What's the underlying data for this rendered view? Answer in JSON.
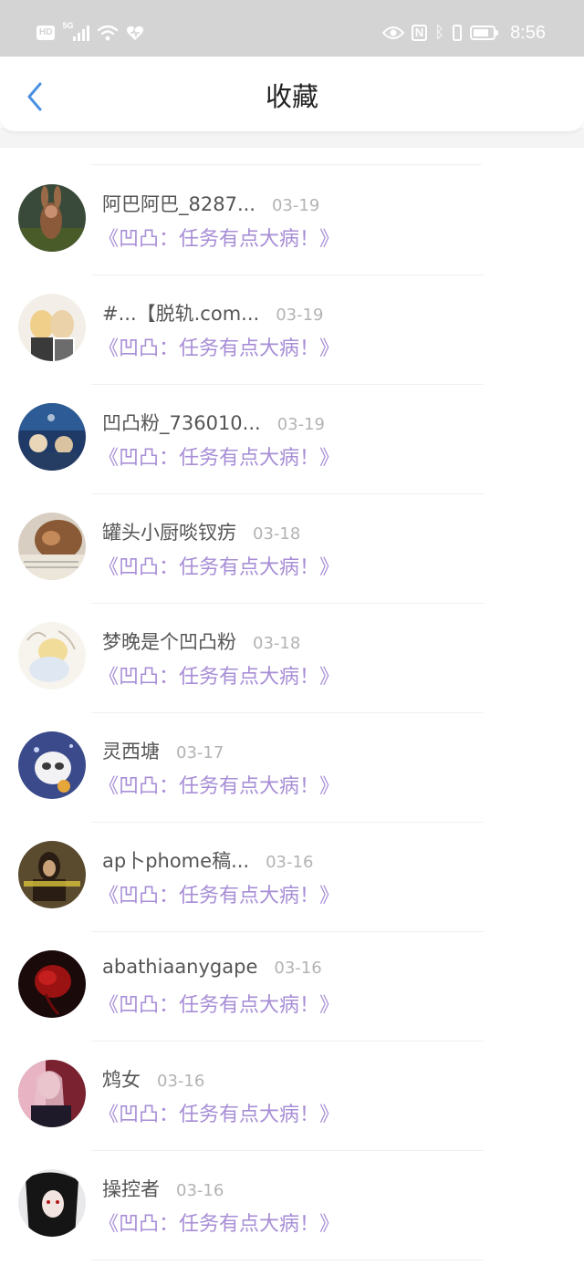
{
  "status_bar": {
    "hd": "HD",
    "network": "5G",
    "nfc": "N",
    "time": "8:56",
    "battery_percent": 80
  },
  "header": {
    "title": "收藏",
    "back_icon": "chevron-left-icon"
  },
  "colors": {
    "accent": "#4a90e2",
    "book_title": "#a78ed6",
    "name": "#555555",
    "date": "#b3b3b3"
  },
  "items": [
    {
      "name": "阿巴阿巴_8287...",
      "date": "03-19",
      "book": "《凹凸：任务有点大病！》"
    },
    {
      "name": "#...【脱轨.com...",
      "date": "03-19",
      "book": "《凹凸：任务有点大病！》"
    },
    {
      "name": "凹凸粉_736010...",
      "date": "03-19",
      "book": "《凹凸：任务有点大病！》"
    },
    {
      "name": "罐头小厨啖钗疠",
      "date": "03-18",
      "book": "《凹凸：任务有点大病！》"
    },
    {
      "name": "梦晚是个凹凸粉",
      "date": "03-18",
      "book": "《凹凸：任务有点大病！》"
    },
    {
      "name": "灵西塘",
      "date": "03-17",
      "book": "《凹凸：任务有点大病！》"
    },
    {
      "name": "ap卜phome稿...",
      "date": "03-16",
      "book": "《凹凸：任务有点大病！》"
    },
    {
      "name": "abathiaanygape",
      "date": "03-16",
      "book": "《凹凸：任务有点大病！》"
    },
    {
      "name": "鸩女",
      "date": "03-16",
      "book": "《凹凸：任务有点大病！》"
    },
    {
      "name": "操控者",
      "date": "03-16",
      "book": "《凹凸：任务有点大病！》"
    }
  ]
}
